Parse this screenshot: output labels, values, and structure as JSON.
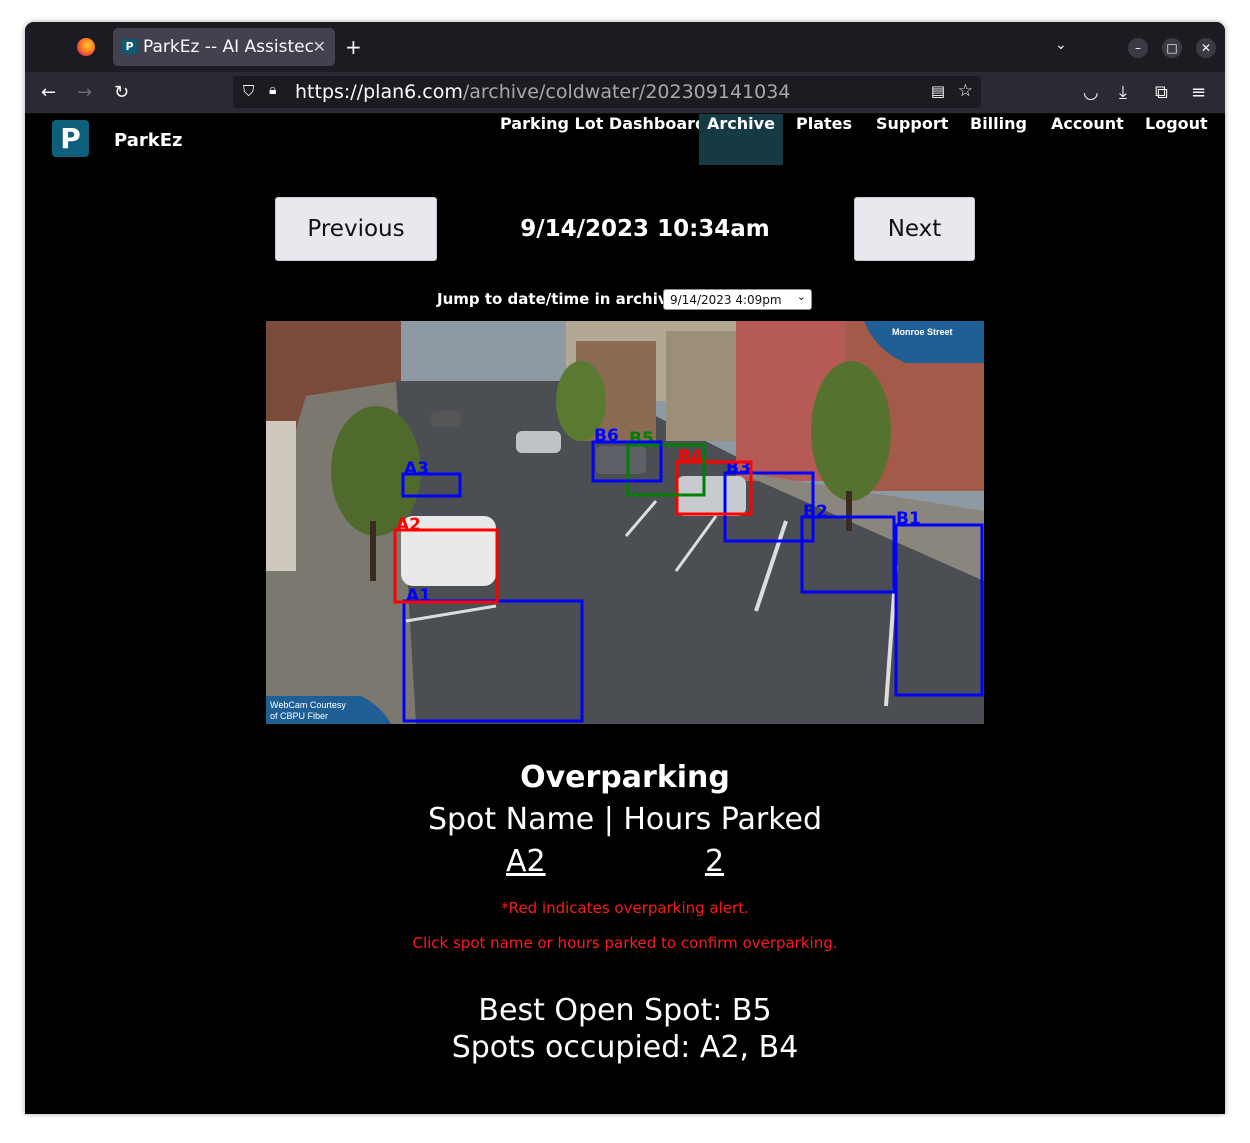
{
  "browser": {
    "tab_title": "ParkEz -- AI Assistec",
    "tab_favicon": "P",
    "url_host": "https://plan6.com",
    "url_path": "/archive/coldwater/202309141034"
  },
  "site": {
    "logo_letter": "P",
    "brand": "ParkEz",
    "nav": [
      "Parking Lot Dashboard",
      "Archive",
      "Plates",
      "Support",
      "Billing",
      "Account",
      "Logout"
    ],
    "active_nav": "Archive"
  },
  "archive": {
    "previous_label": "Previous",
    "next_label": "Next",
    "timestamp": "9/14/2023 10:34am",
    "jump_label": "Jump to date/time in archive:",
    "jump_selected": "9/14/2023 4:09pm"
  },
  "camera": {
    "overlay_top": "Monroe Street",
    "overlay_bottom_1": "WebCam Courtesy",
    "overlay_bottom_2": "of CBPU Fiber",
    "spots": [
      {
        "name": "A1",
        "color": "#0000ff"
      },
      {
        "name": "A2",
        "color": "#ff0000"
      },
      {
        "name": "A3",
        "color": "#0000ff"
      },
      {
        "name": "B1",
        "color": "#0000ff"
      },
      {
        "name": "B2",
        "color": "#0000ff"
      },
      {
        "name": "B3",
        "color": "#0000ff"
      },
      {
        "name": "B4",
        "color": "#ff0000"
      },
      {
        "name": "B5",
        "color": "#008000"
      },
      {
        "name": "B6",
        "color": "#0000ff"
      }
    ]
  },
  "overparking": {
    "title": "Overparking",
    "header": "Spot Name | Hours Parked",
    "spot": "A2",
    "hours": "2",
    "note1": "*Red indicates overparking alert.",
    "note2": "Click spot name or hours parked to confirm overparking."
  },
  "summary": {
    "best_open": "Best Open Spot: B5",
    "occupied": "Spots occupied: A2, B4"
  },
  "colors": {
    "accent": "#0e5f7c",
    "active_nav_bg": "#163a44",
    "alert_red": "#ff1a1a"
  }
}
